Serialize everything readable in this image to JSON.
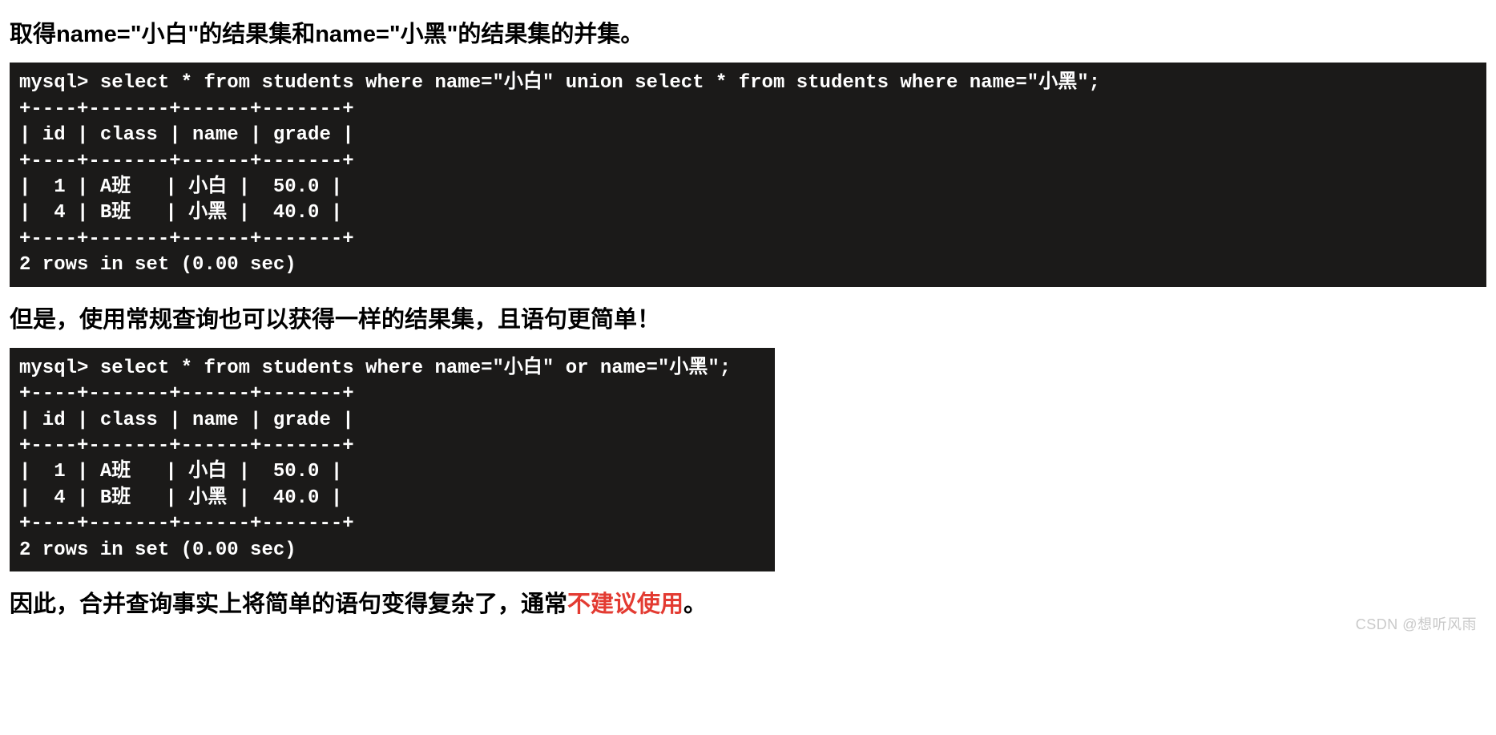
{
  "headings": {
    "h1": "取得name=\"小白\"的结果集和name=\"小黑\"的结果集的并集。",
    "h2": "但是，使用常规查询也可以获得一样的结果集，且语句更简单！",
    "h3_pre": "因此，合并查询事实上将简单的语句变得复杂了，通常",
    "h3_red": "不建议使用",
    "h3_post": "。"
  },
  "code1": "mysql> select * from students where name=\"小白\" union select * from students where name=\"小黑\";\n+----+-------+------+-------+\n| id | class | name | grade |\n+----+-------+------+-------+\n|  1 | A班   | 小白 |  50.0 |\n|  4 | B班   | 小黑 |  40.0 |\n+----+-------+------+-------+\n2 rows in set (0.00 sec)",
  "code2": "mysql> select * from students where name=\"小白\" or name=\"小黑\";\n+----+-------+------+-------+\n| id | class | name | grade |\n+----+-------+------+-------+\n|  1 | A班   | 小白 |  50.0 |\n|  4 | B班   | 小黑 |  40.0 |\n+----+-------+------+-------+\n2 rows in set (0.00 sec)",
  "watermark": "CSDN @想听风雨"
}
